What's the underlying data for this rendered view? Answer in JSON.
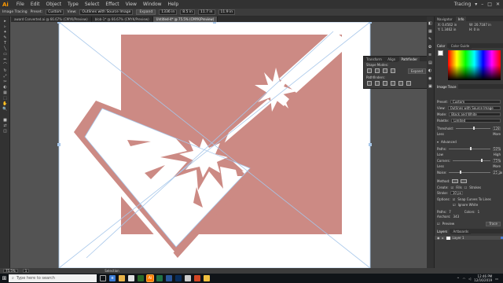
{
  "app": {
    "logo": "Ai",
    "workspace": "Tracing"
  },
  "menu": [
    "File",
    "Edit",
    "Object",
    "Type",
    "Select",
    "Effect",
    "View",
    "Window",
    "Help"
  ],
  "control": {
    "label": "Image Tracing",
    "preset_label": "Preset:",
    "preset_value": "Custom",
    "view_label": "View:",
    "view_value": "Outlines with Source Image",
    "expand_label": "Expand",
    "x_value": "1336 in",
    "y_value": "8.5 in",
    "w_value": "11.7 in",
    "h_value": "11.9 in"
  },
  "tabs": [
    {
      "label": "award Converted.ai @ 66.67% (CMYK/Preview)",
      "active": false
    },
    {
      "label": "blob-1* @ 66.67% (CMYK/Preview)",
      "active": false
    },
    {
      "label": "Untitled-4* @ 75.5% (CMYK/Preview)",
      "active": true
    }
  ],
  "tools": [
    "▸",
    "▹",
    "✦",
    "✎",
    "T",
    "╲",
    "▭",
    "✏",
    "⌒",
    "↻",
    "⤢",
    "✂",
    "◐",
    "▦",
    "⬚",
    "✋",
    "🔍",
    "■",
    "⇄",
    "◫"
  ],
  "right": {
    "tab1": "Navigator",
    "tab2": "Info",
    "info_x": "X: 0.4562 in",
    "info_y": "Y: 1.3462 in",
    "info_w": "W: 20.7187 in",
    "info_h": "H: 0 in",
    "color_tabs": [
      "Color",
      "Color Guide"
    ],
    "trace": {
      "title": "Image Trace",
      "preset_label": "Preset:",
      "preset_value": "Custom",
      "view_label": "View:",
      "view_value": "Outlines with Source Image",
      "mode_label": "Mode:",
      "mode_value": "Black and White",
      "palette_label": "Palette:",
      "palette_value": "Limited",
      "threshold_label": "Threshold:",
      "threshold_value": "128",
      "less": "Less",
      "more": "More",
      "advanced": "Advanced",
      "paths_label": "Paths:",
      "paths_value": "50%",
      "corners_label": "Corners:",
      "corners_value": "75%",
      "noise_label": "Noise:",
      "noise_value": "25 px",
      "low": "Low",
      "high": "High",
      "method_label": "Method:",
      "create_label": "Create:",
      "fills": "Fills",
      "strokes": "Strokes",
      "stroke_label": "Stroke:",
      "stroke_value": "10 px",
      "options_label": "Options:",
      "snap": "Snap Curves To Lines",
      "ignore": "Ignore White",
      "paths_count_label": "Paths:",
      "paths_count": "7",
      "colors_label": "Colors:",
      "colors_count": "1",
      "anchors_label": "Anchors:",
      "anchors_count": "343",
      "preview": "Preview",
      "trace_btn": "Trace"
    },
    "layers_tabs": [
      "Layers",
      "Artboards"
    ],
    "layer_name": "Layer 1"
  },
  "pathfinder": {
    "tab1": "Transform",
    "tab2": "Align",
    "tab3": "Pathfinder",
    "shape_modes": "Shape Modes:",
    "pathfinders": "Pathfinders:",
    "expand": "Expand"
  },
  "status": {
    "zoom": "75.5%",
    "page": "1",
    "tool": "Selection"
  },
  "taskbar": {
    "search_placeholder": "Type here to search",
    "time": "12:46 PM",
    "date": "12/16/2019"
  },
  "colors": {
    "artwork_fill": "#cc8a84",
    "trace_outline": "#a7c7ea",
    "accent": "#ff9a00"
  }
}
